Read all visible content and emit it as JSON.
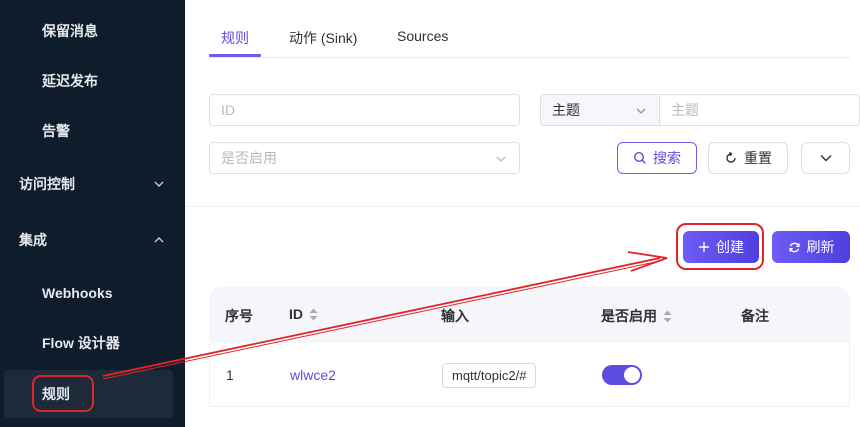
{
  "sidebar": {
    "items": [
      {
        "label": "保留消息"
      },
      {
        "label": "延迟发布"
      },
      {
        "label": "告警"
      },
      {
        "label": "访问控制"
      },
      {
        "label": "集成"
      },
      {
        "label": "Webhooks"
      },
      {
        "label": "Flow 设计器"
      },
      {
        "label": "规则"
      }
    ]
  },
  "tabs": [
    "规则",
    "动作 (Sink)",
    "Sources"
  ],
  "filters": {
    "id_placeholder": "ID",
    "topic_select_value": "主题",
    "topic_placeholder": "主题",
    "enabled_placeholder": "是否启用",
    "search_label": "搜索",
    "reset_label": "重置"
  },
  "actions": {
    "create_label": "创建",
    "refresh_label": "刷新"
  },
  "table": {
    "columns": [
      "序号",
      "ID",
      "输入",
      "是否启用",
      "备注"
    ],
    "rows": [
      {
        "index": "1",
        "id": "wlwce2",
        "input": "mqtt/topic2/#",
        "enabled": true,
        "note": ""
      }
    ]
  },
  "colors": {
    "sidebar_bg": "#0f1c2b",
    "accent": "#5d4ce0",
    "annotation_red": "#e0242a"
  }
}
